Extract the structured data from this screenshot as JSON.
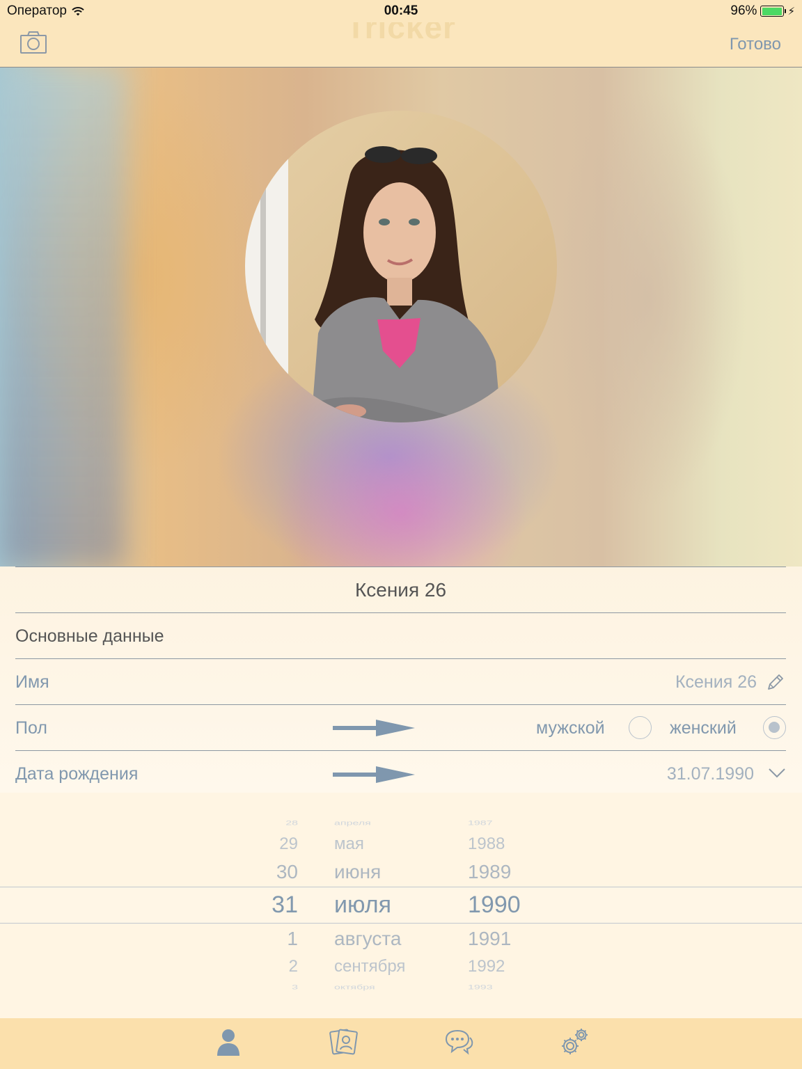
{
  "status_bar": {
    "carrier": "Оператор",
    "time": "00:45",
    "battery": "96%",
    "battery_level": 0.96
  },
  "nav": {
    "title": "Tricker",
    "done_label": "Готово",
    "camera_icon": "camera-icon"
  },
  "profile": {
    "display_name": "Ксения 26",
    "section_title": "Основные данные",
    "name_label": "Имя",
    "name_value": "Ксения 26",
    "gender_label": "Пол",
    "gender_male": "мужской",
    "gender_female": "женский",
    "gender_selected": "женский",
    "birth_label": "Дата рождения",
    "birth_value": "31.07.1990"
  },
  "picker": {
    "days": [
      "28",
      "29",
      "30",
      "31",
      "1",
      "2",
      "3"
    ],
    "months": [
      "апреля",
      "мая",
      "июня",
      "июля",
      "августа",
      "сентября",
      "октября"
    ],
    "years": [
      "1987",
      "1988",
      "1989",
      "1990",
      "1991",
      "1992",
      "1993"
    ],
    "selected_index": 3
  },
  "tabs": [
    {
      "icon": "profile-icon"
    },
    {
      "icon": "cards-icon"
    },
    {
      "icon": "chat-icon"
    },
    {
      "icon": "settings-icon"
    }
  ],
  "colors": {
    "bar_background": "#fbe6bd",
    "accent": "#7f97ae",
    "icon": "#7f97ae"
  }
}
